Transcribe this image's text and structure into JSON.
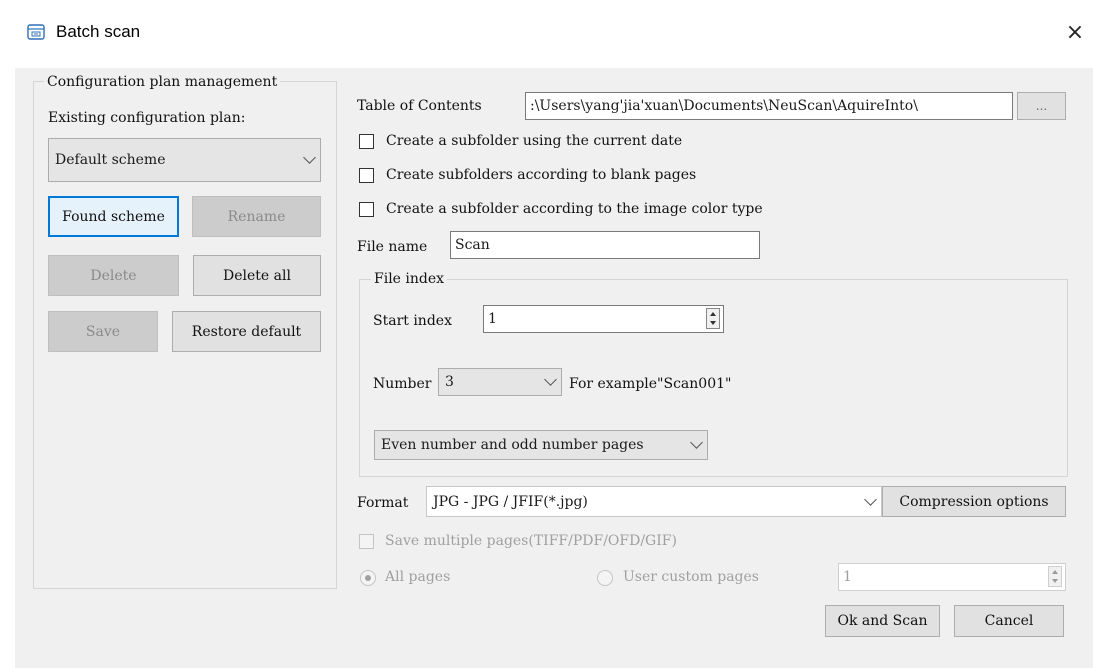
{
  "window": {
    "title": "Batch scan",
    "close_glyph": "×"
  },
  "config": {
    "group_title": "Configuration plan management",
    "existing_label": "Existing configuration plan:",
    "plan_selected": "Default scheme",
    "buttons": {
      "found": "Found scheme",
      "rename": "Rename",
      "delete": "Delete",
      "delete_all": "Delete all",
      "save": "Save",
      "restore": "Restore default"
    }
  },
  "toc": {
    "label": "Table of Contents",
    "path": ":\\Users\\yang'jia'xuan\\Documents\\NeuScan\\AquireInto\\",
    "browse": "..."
  },
  "options": {
    "subfolder_date": "Create a subfolder using the current date",
    "subfolder_blank": "Create subfolders according to blank pages",
    "subfolder_color": "Create a subfolder according to the image color type"
  },
  "file_name": {
    "label": "File name",
    "value": "Scan"
  },
  "file_index": {
    "title": "File index",
    "start_label": "Start index",
    "start_value": "1",
    "number_label": "Number",
    "number_value": "3",
    "example": "For example\"Scan001\"",
    "pages_option": "Even number and odd number pages"
  },
  "format": {
    "label": "Format",
    "value": "JPG - JPG / JFIF(*.jpg)",
    "compression": "Compression options"
  },
  "multi": {
    "save_multiple": "Save multiple pages(TIFF/PDF/OFD/GIF)",
    "all_pages": "All pages",
    "custom_pages": "User custom pages",
    "custom_value": "1"
  },
  "actions": {
    "ok": "Ok and Scan",
    "cancel": "Cancel"
  },
  "icons": {
    "app": "scanner-window-icon",
    "close": "close-icon",
    "dropdown": "chevron-down-icon",
    "spin": "spin-arrows-icon"
  }
}
